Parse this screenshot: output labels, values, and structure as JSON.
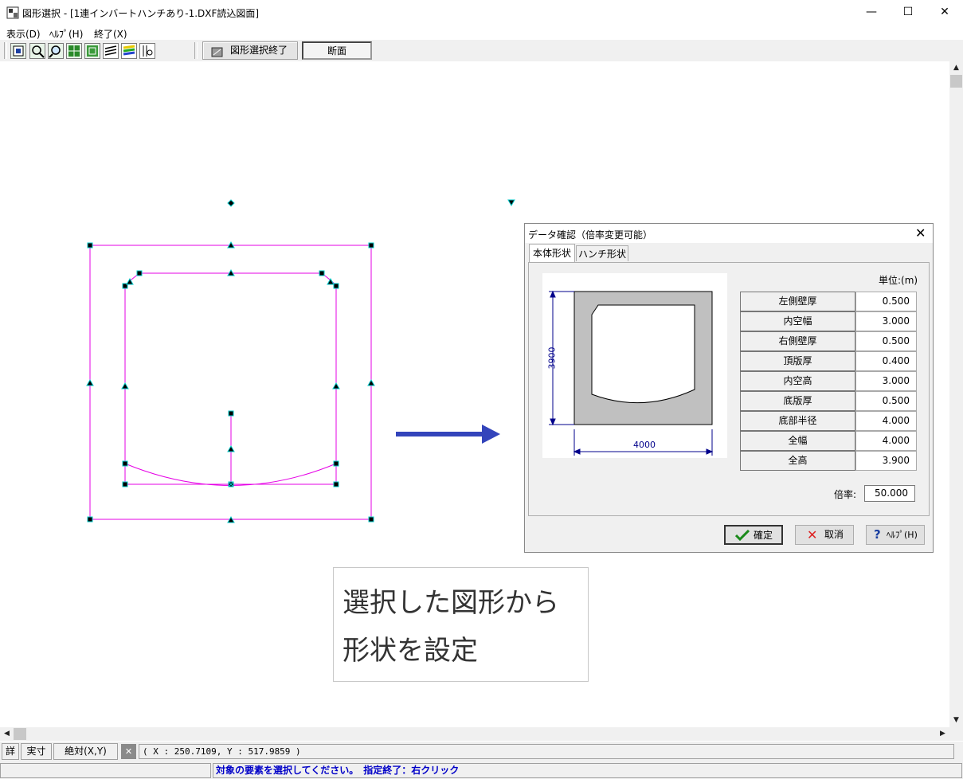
{
  "window": {
    "title": "図形選択 - [1連インバートハンチあり-1.DXF読込図面]",
    "controls": {
      "minimize": "—",
      "maximize": "☐",
      "close": "✕"
    }
  },
  "menu": [
    {
      "label": "表示(D)"
    },
    {
      "label": "ﾍﾙﾌﾟ(H)"
    },
    {
      "label": "終了(X)"
    }
  ],
  "toolbar": {
    "icons": [
      "select-icon",
      "zoom-window-icon",
      "zoom-in-icon",
      "grid-select-icon",
      "grid-area-icon",
      "layers-icon",
      "color-layers-icon",
      "measure-icon"
    ],
    "finish_button": "図形選択終了",
    "section_button": "断面"
  },
  "dialog": {
    "title": "データ確認（倍率変更可能）",
    "tabs": [
      {
        "label": "本体形状"
      },
      {
        "label": "ハンチ形状"
      }
    ],
    "unit": "単位:(m)",
    "preview": {
      "height_label": "3900",
      "width_label": "4000"
    },
    "params": [
      {
        "label": "左側壁厚",
        "value": "0.500"
      },
      {
        "label": "内空幅",
        "value": "3.000"
      },
      {
        "label": "右側壁厚",
        "value": "0.500"
      },
      {
        "label": "頂版厚",
        "value": "0.400"
      },
      {
        "label": "内空高",
        "value": "3.000"
      },
      {
        "label": "底版厚",
        "value": "0.500"
      },
      {
        "label": "底部半径",
        "value": "4.000"
      },
      {
        "label": "全幅",
        "value": "4.000"
      },
      {
        "label": "全高",
        "value": "3.900"
      }
    ],
    "scale_label": "倍率:",
    "scale_value": "50.000",
    "buttons": {
      "ok": "確定",
      "cancel": "取消",
      "help": "ﾍﾙﾌﾟ(H)"
    }
  },
  "note": {
    "line1": "選択した図形から",
    "line2": "形状を設定"
  },
  "status": {
    "buttons": [
      "詳",
      "実寸",
      "絶対(X,Y)"
    ],
    "coordinates": "( X : 250.7109, Y : 517.9859 )",
    "message": "対象の要素を選択してください。　指定終了：右クリック"
  },
  "colors": {
    "drawing": "#e600e6",
    "handle": "#00c8c8",
    "arrow": "#3344bb",
    "status_text": "#0000c8"
  }
}
